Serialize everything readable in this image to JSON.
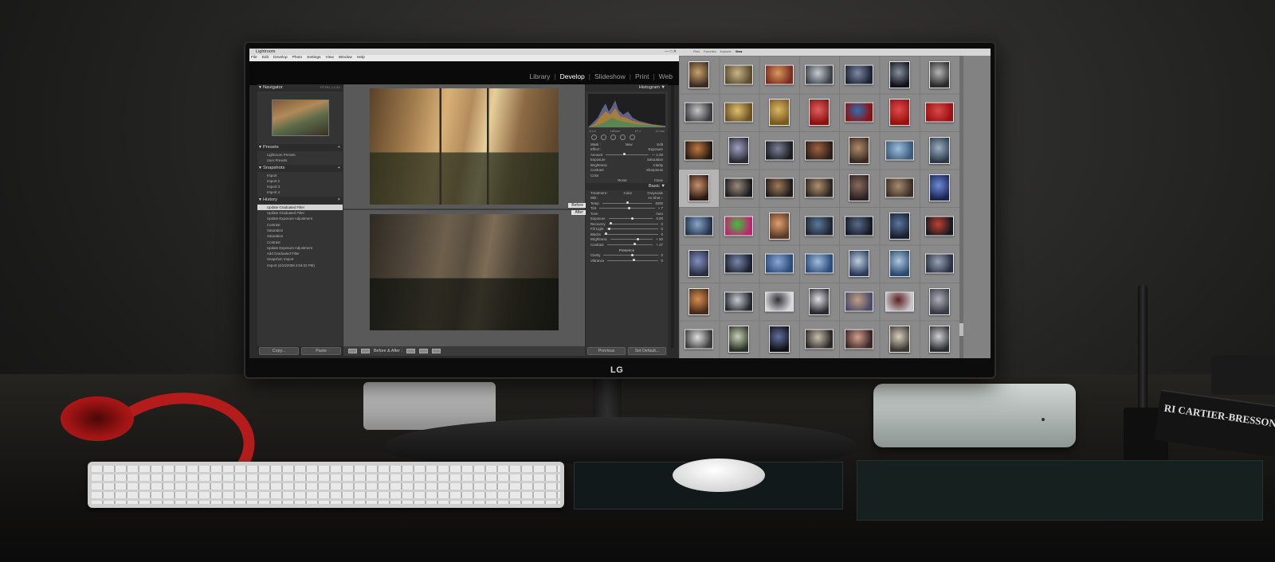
{
  "brand": {
    "logo": "LG"
  },
  "book": {
    "title": "RI CARTIER-BRESSON PHOTO"
  },
  "lightroom": {
    "title": "Lightroom",
    "window_controls": "— □ ✕",
    "menu": [
      "File",
      "Edit",
      "Develop",
      "Photo",
      "Settings",
      "View",
      "Window",
      "Help"
    ],
    "modules": [
      "Library",
      "Develop",
      "Slideshow",
      "Print",
      "Web"
    ],
    "active_module": "Develop",
    "left_panel": {
      "navigator": {
        "title": "Navigator",
        "zoom": "FIT  FILL  1:1  3:1"
      },
      "presets": {
        "title": "Presets",
        "items": [
          "Lightroom Presets",
          "User Presets"
        ]
      },
      "snapshots": {
        "title": "Snapshots",
        "items": [
          "Import",
          "Import 2",
          "Import 3",
          "Import 4"
        ]
      },
      "history": {
        "title": "History",
        "items": [
          "Update Graduated Filter",
          "Update Graduated Filter",
          "Update Exposure Adjustment",
          "Contrast",
          "Saturation",
          "Saturation",
          "Contrast",
          "Update Exposure Adjustment",
          "Add Graduated Filter",
          "Snapshot: Import",
          "Import (4/10/2008 2:04:02 PM)"
        ],
        "selected_index": 0
      },
      "copy": "Copy...",
      "paste": "Paste"
    },
    "center": {
      "before_label": "Before",
      "after_label": "After",
      "toolbar_label": "Before & After :"
    },
    "right_panel": {
      "histogram_title": "Histogram",
      "histogram_values": [
        "1/1,6",
        "180mm",
        "f/7,1",
        "12 mm"
      ],
      "mask_row": [
        "Mask :",
        "New",
        "Edit"
      ],
      "effect_rows": [
        [
          "Effect :",
          "Exposure"
        ],
        [
          "Amount",
          "— 1.00"
        ]
      ],
      "adjust_rows": [
        [
          "Exposure",
          "Saturation"
        ],
        [
          "Brightness",
          "Clarity"
        ],
        [
          "Contrast",
          "Sharpness"
        ],
        [
          "Color",
          ""
        ]
      ],
      "reset_close": [
        "Reset",
        "Close"
      ],
      "basic_title": "Basic",
      "treatment": [
        "Treatment :",
        "Color",
        "Grayscale"
      ],
      "wb": [
        "WB :",
        "As Shot ÷"
      ],
      "temp_rows": [
        [
          "Temp",
          "4000"
        ],
        [
          "Tint",
          "+ 7"
        ]
      ],
      "tone_label": "Tone",
      "tone_auto": "Auto",
      "tone_rows": [
        [
          "Exposure",
          "0.00"
        ],
        [
          "Recovery",
          "0"
        ],
        [
          "Fill Light",
          "0"
        ],
        [
          "Blacks",
          "0"
        ],
        [
          "Brightness",
          "+ 50"
        ],
        [
          "Contrast",
          "+ 27"
        ]
      ],
      "presence_label": "Presence",
      "presence_rows": [
        [
          "Clarity",
          "0"
        ],
        [
          "Vibrance",
          "0"
        ]
      ],
      "previous": "Previous",
      "set_default": "Set Default..."
    }
  },
  "file_browser": {
    "tabs": [
      "Files",
      "Favorites",
      "Explorer",
      "View"
    ],
    "active_tab": "View",
    "selected_index": 21,
    "thumbnails": [
      [
        "#3b2b22",
        "#c8a36a"
      ],
      [
        "#5a4c2e",
        "#c9b48a"
      ],
      [
        "#7a2a20",
        "#d89a5a"
      ],
      [
        "#3b3f46",
        "#c7ccd3"
      ],
      [
        "#1c2230",
        "#7d89a5"
      ],
      [
        "#101218",
        "#8a90a0"
      ],
      [
        "#2a2a2a",
        "#b5b5b5"
      ],
      [
        "#3a3a3e",
        "#c6c6c6"
      ],
      [
        "#6b5020",
        "#e0c070"
      ],
      [
        "#7a5a20",
        "#d9b865"
      ],
      [
        "#8b1010",
        "#e06060"
      ],
      [
        "#8b1010",
        "#3070b0"
      ],
      [
        "#9a1010",
        "#e04a4a"
      ],
      [
        "#9a1010",
        "#d84a4a"
      ],
      [
        "#241812",
        "#c07840"
      ],
      [
        "#2a2a35",
        "#a0a0c0"
      ],
      [
        "#1a1c22",
        "#7a8094"
      ],
      [
        "#2a1e16",
        "#a06040"
      ],
      [
        "#3a2a24",
        "#b08a6a"
      ],
      [
        "#3c5a7a",
        "#9cc0dc"
      ],
      [
        "#2a3a48",
        "#9bb0c4"
      ],
      [
        "#2a1a14",
        "#c8906a"
      ],
      [
        "#1a1a1e",
        "#9a8a7a"
      ],
      [
        "#1e1a1a",
        "#a07a5a"
      ],
      [
        "#2a2420",
        "#b09070"
      ],
      [
        "#2a2222",
        "#8a6a5a"
      ],
      [
        "#3a2e24",
        "#a88a70"
      ],
      [
        "#1a2450",
        "#6c8ad8"
      ],
      [
        "#22324a",
        "#8aa6c8"
      ],
      [
        "#c02070",
        "#40c040"
      ],
      [
        "#5a3a24",
        "#e0a070"
      ],
      [
        "#1e2430",
        "#5a7a9a"
      ],
      [
        "#141a24",
        "#5a6a8a"
      ],
      [
        "#182030",
        "#5a76a0"
      ],
      [
        "#141820",
        "#c04030"
      ],
      [
        "#2a2e3e",
        "#8090c0"
      ],
      [
        "#1a2030",
        "#7a88a8"
      ],
      [
        "#2a4a7a",
        "#8aa8d0"
      ],
      [
        "#2a4a7a",
        "#a0bcdc"
      ],
      [
        "#2a3a5a",
        "#c0d0e0"
      ],
      [
        "#2a4a70",
        "#b0c8e0"
      ],
      [
        "#2a3040",
        "#9aa4b8"
      ],
      [
        "#4a2a1a",
        "#d89050"
      ],
      [
        "#24282e",
        "#c8ccd2"
      ],
      [
        "#d8d8dc",
        "#303038"
      ],
      [
        "#2a2a30",
        "#e0e0e6"
      ],
      [
        "#4a4a6a",
        "#c0a080"
      ],
      [
        "#c8c8cc",
        "#5a2020"
      ],
      [
        "#3a3a44",
        "#b0b0bc"
      ],
      [
        "#3a3a3a",
        "#e0e0e0"
      ],
      [
        "#2a3024",
        "#c8d0b8"
      ],
      [
        "#101014",
        "#6070a0"
      ],
      [
        "#2a2624",
        "#c8c0b0"
      ],
      [
        "#3a2422",
        "#d0a090"
      ],
      [
        "#3a3630",
        "#d8d0c0"
      ],
      [
        "#2a2c30",
        "#d0d0d4"
      ]
    ]
  }
}
